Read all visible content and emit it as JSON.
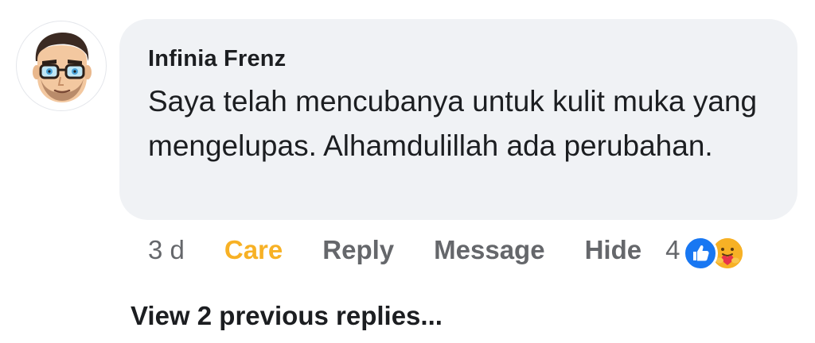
{
  "comment": {
    "author": "Infinia Frenz",
    "text": "Saya telah mencubanya untuk kulit muka yang mengelupas. Alhamdulillah ada perubahan.",
    "avatar_icon": "cartoon-man-glasses-avatar"
  },
  "actions": {
    "time": "3 d",
    "care_label": "Care",
    "reply_label": "Reply",
    "message_label": "Message",
    "hide_label": "Hide",
    "reaction_count": "4",
    "reaction_icons": [
      "like-icon",
      "care-icon"
    ]
  },
  "view_replies": "View 2 previous replies...",
  "colors": {
    "care": "#f7b125",
    "like": "#1877f2",
    "bubble": "#f0f2f5",
    "muted_text": "#65676b"
  }
}
